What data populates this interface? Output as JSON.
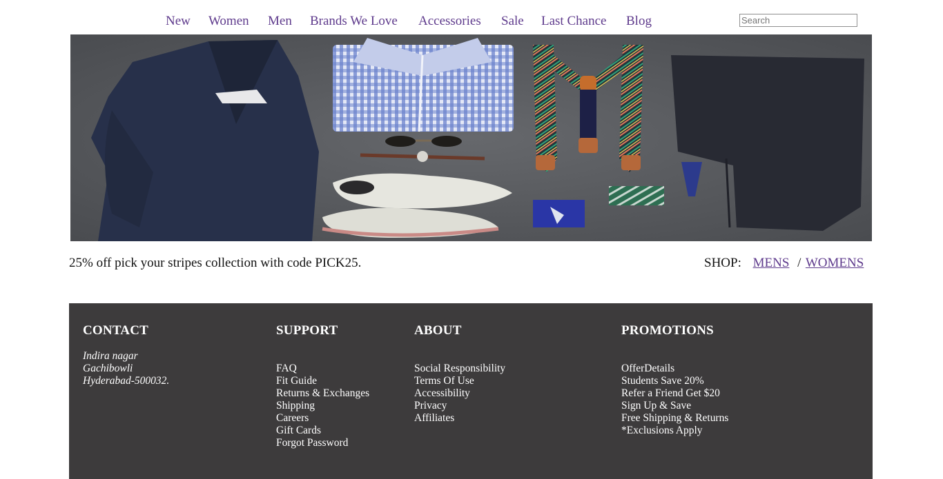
{
  "nav": {
    "items": [
      {
        "label": "New"
      },
      {
        "label": "Women"
      },
      {
        "label": "Men"
      },
      {
        "label": "Brands We Love"
      },
      {
        "label": "Accessories"
      },
      {
        "label": "Sale"
      },
      {
        "label": "Last Chance"
      },
      {
        "label": "Blog"
      }
    ],
    "search_placeholder": "Search"
  },
  "hero": {
    "alt": "Flat-lay of menswear: navy blazer, gingham shirt, striped suspenders, trousers, sunglasses, watch and white shoes"
  },
  "promo": {
    "text": "25% off pick your stripes collection with code PICK25.",
    "shop_label": "SHOP:",
    "mens": "MENS",
    "separator": "/",
    "womens": "WOMENS"
  },
  "footer": {
    "contact": {
      "heading": "CONTACT",
      "address": [
        "Indira nagar",
        "Gachibowli",
        "Hyderabad-500032."
      ]
    },
    "support": {
      "heading": "SUPPORT",
      "links": [
        "FAQ",
        "Fit Guide",
        "Returns & Exchanges",
        "Shipping",
        "Careers",
        "Gift Cards",
        "Forgot Password"
      ]
    },
    "about": {
      "heading": "ABOUT",
      "links": [
        "Social Responsibility",
        "Terms Of Use",
        "Accessibility",
        "Privacy",
        "Affiliates"
      ]
    },
    "promotions": {
      "heading": "PROMOTIONS",
      "links": [
        "OfferDetails",
        "Students Save 20%",
        "Refer a Friend Get $20",
        "Sign Up & Save",
        "Free Shipping & Returns",
        "*Exclusions Apply"
      ]
    }
  },
  "colors": {
    "link": "#5e3a8c",
    "footer_bg": "#3d3b3c"
  }
}
